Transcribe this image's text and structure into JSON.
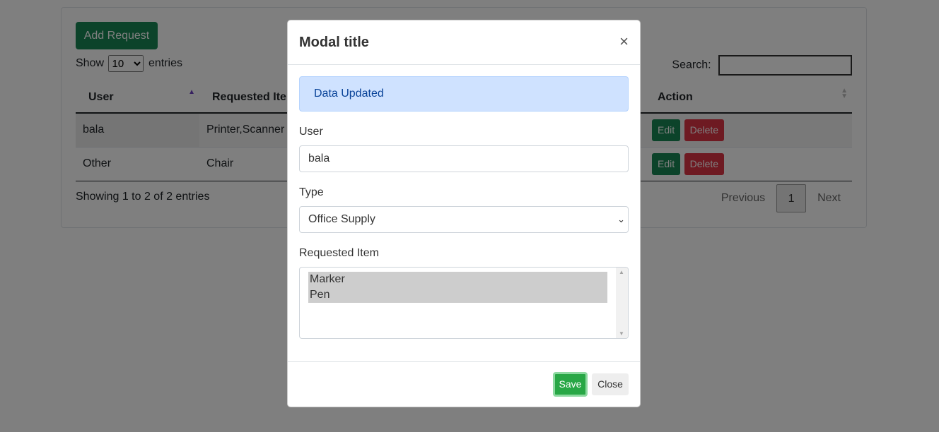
{
  "page": {
    "add_button": "Add Request",
    "length": {
      "show": "Show",
      "value": "10",
      "entries": "entries"
    },
    "search": {
      "label": "Search:",
      "value": ""
    },
    "table": {
      "headers": [
        "User",
        "Requested Item",
        "Action"
      ],
      "rows": [
        {
          "user": "bala",
          "item": "Printer,Scanner"
        },
        {
          "user": "Other",
          "item": "Chair"
        }
      ],
      "edit_label": "Edit",
      "delete_label": "Delete"
    },
    "info": "Showing 1 to 2 of 2 entries",
    "pagination": {
      "previous": "Previous",
      "current": "1",
      "next": "Next"
    }
  },
  "modal": {
    "title": "Modal title",
    "close_symbol": "×",
    "alert": "Data Updated",
    "user_label": "User",
    "user_value": "bala",
    "type_label": "Type",
    "type_value": "Office Supply",
    "item_label": "Requested Item",
    "item_options": [
      "Marker",
      "Pen"
    ],
    "save_label": "Save",
    "close_label": "Close"
  },
  "colors": {
    "success": "#198754",
    "danger": "#dc3545",
    "alert_bg": "#cfe2ff"
  },
  "icons": {
    "close": "close-icon",
    "sort": "sort-asc-icon",
    "caret": "chevron-down-icon"
  }
}
